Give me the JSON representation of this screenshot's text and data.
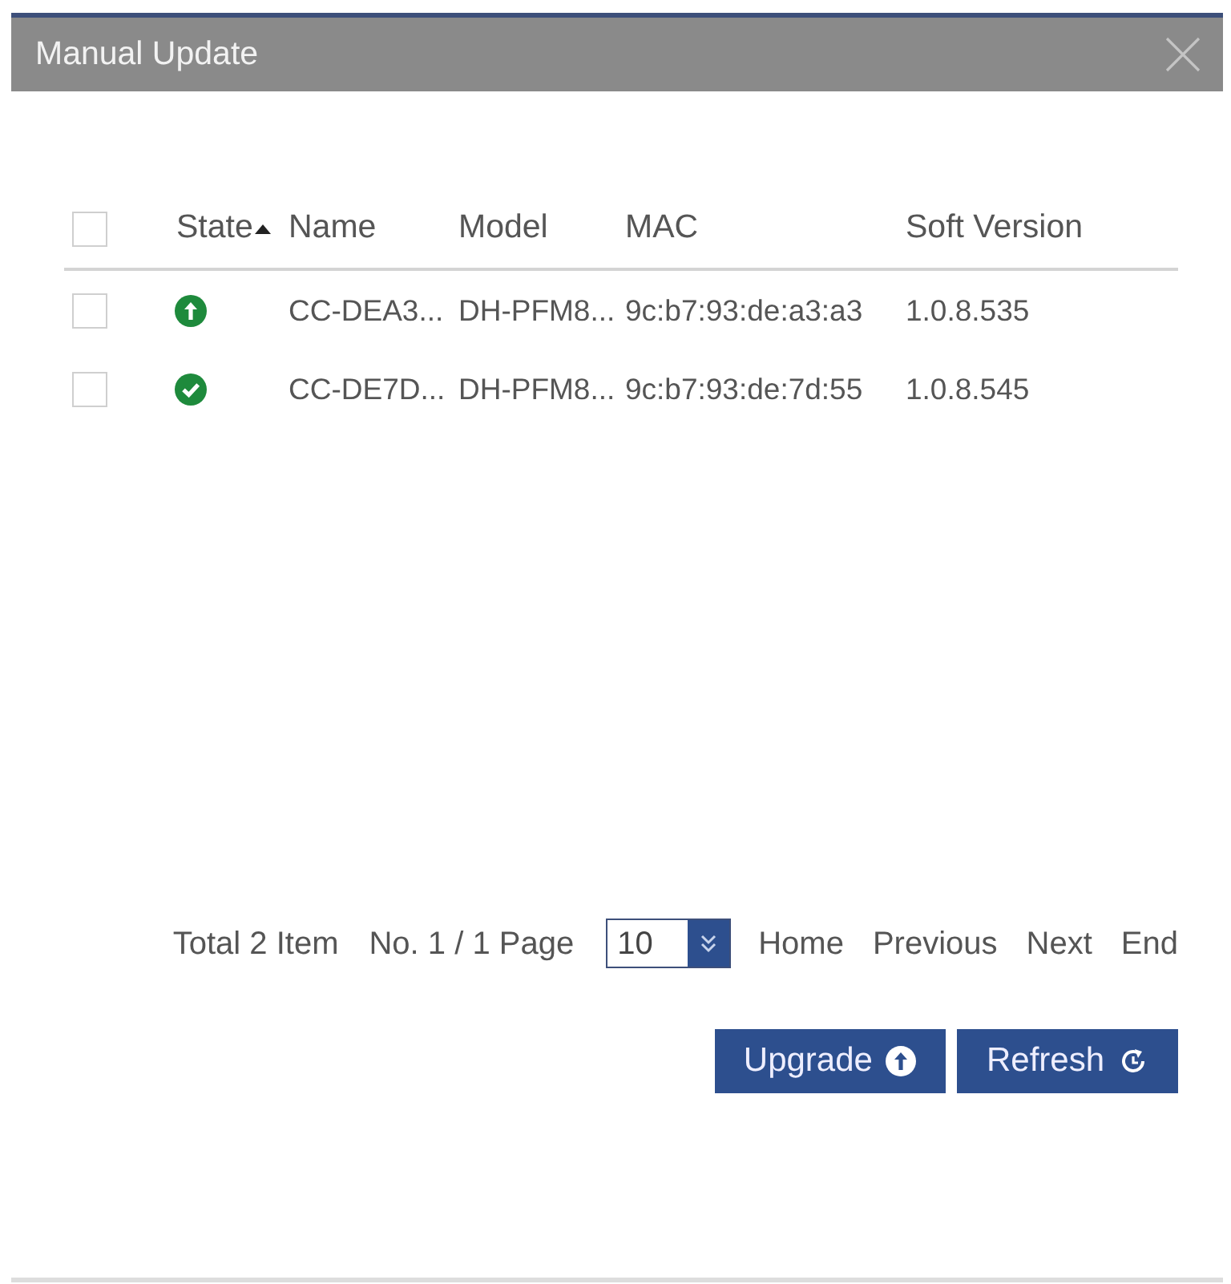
{
  "window": {
    "title": "Manual Update"
  },
  "table": {
    "select_all": {
      "checked": false
    },
    "columns": [
      {
        "label": "State",
        "sorted": true
      },
      {
        "label": "Name",
        "sorted": false
      },
      {
        "label": "Model",
        "sorted": false
      },
      {
        "label": "MAC",
        "sorted": false
      },
      {
        "label": "Soft Version",
        "sorted": false
      }
    ],
    "rows": [
      {
        "checked": false,
        "kind": "upgradable",
        "name": "CC-DEA3...",
        "model": "DH-PFM8...",
        "mac": "9c:b7:93:de:a3:a3",
        "soft_version": "1.0.8.535"
      },
      {
        "checked": false,
        "kind": "current",
        "name": "CC-DE7D...",
        "model": "DH-PFM8...",
        "mac": "9c:b7:93:de:7d:55",
        "soft_version": "1.0.8.545"
      }
    ]
  },
  "pagination": {
    "total": "Total 2 Item",
    "page": "No. 1 / 1 Page",
    "page_size": "10",
    "links": [
      "Home",
      "Previous",
      "Next",
      "End"
    ]
  },
  "buttons": [
    {
      "label": "Upgrade",
      "kind": "upgrade"
    },
    {
      "label": "Refresh",
      "kind": "refresh"
    }
  ]
}
